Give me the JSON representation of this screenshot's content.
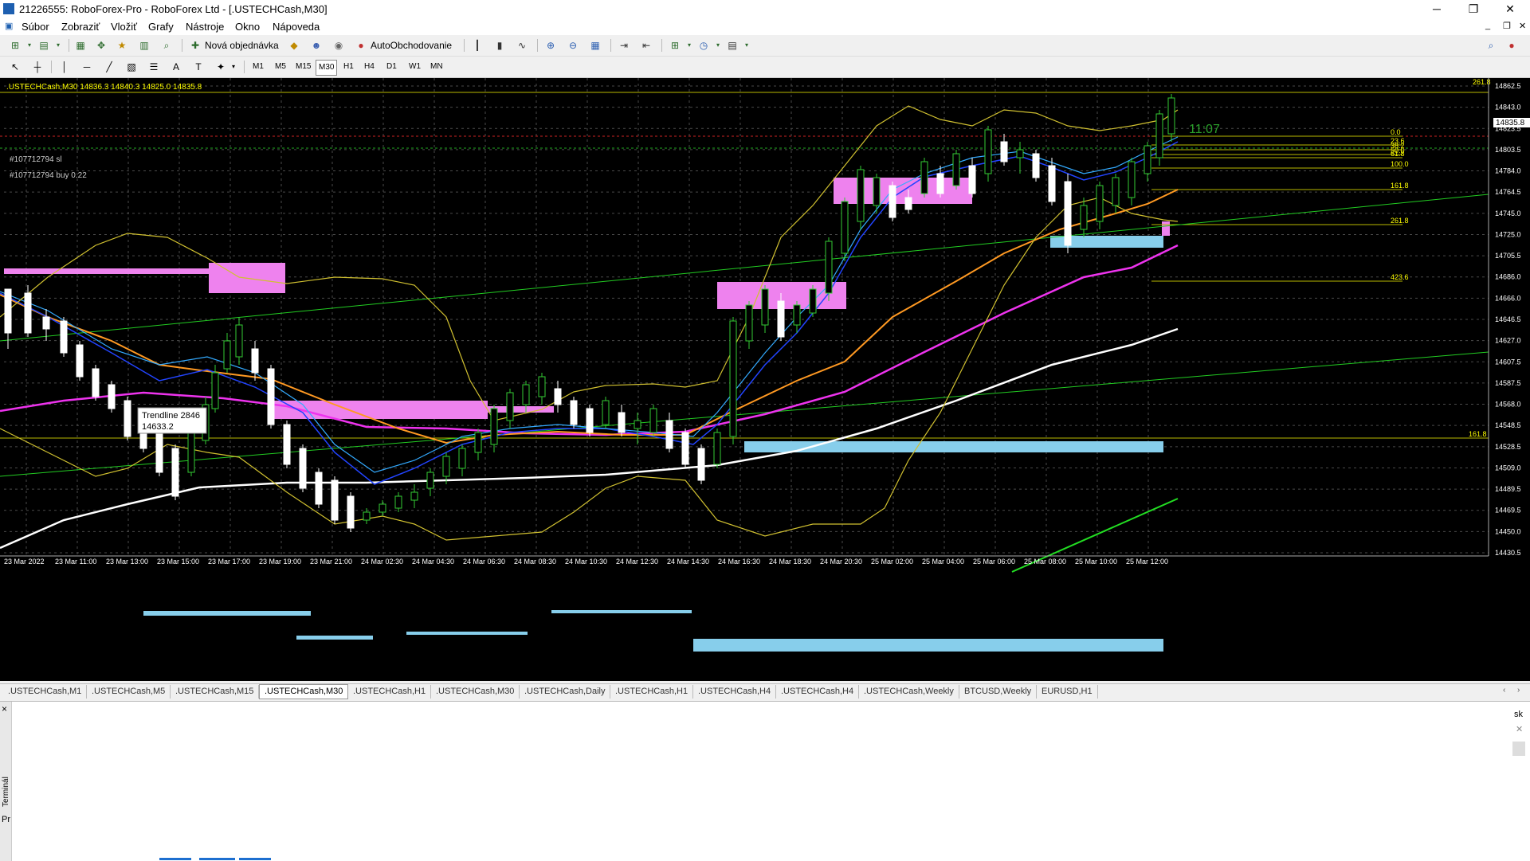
{
  "window": {
    "title": "21226555: RoboForex-Pro - RoboForex Ltd - [.USTECHCash,M30]"
  },
  "menu": [
    "Súbor",
    "Zobraziť",
    "Vložiť",
    "Grafy",
    "Nástroje",
    "Okno",
    "Nápoveda"
  ],
  "toolbar": {
    "new_order": "Nová objednávka",
    "auto_trading": "AutoObchodovanie"
  },
  "timeframes": [
    "M1",
    "M5",
    "M15",
    "M30",
    "H1",
    "H4",
    "D1",
    "W1",
    "MN"
  ],
  "active_timeframe": "M30",
  "chart": {
    "info_line": ".USTECHCash,M30  14836.3 14840.3 14825.0 14835.8",
    "current_price": "14835.8",
    "countdown": "11:07",
    "sl_label": "#107712794 sl",
    "buy_label": "#107712794 buy 0.22",
    "tooltip_line1": "Trendline 2846",
    "tooltip_line2": "14633.2",
    "top_right_label": "261.8",
    "price_ticks": [
      "14862.5",
      "14843.0",
      "14823.5",
      "14803.5",
      "14784.0",
      "14764.5",
      "14745.0",
      "14725.0",
      "14705.5",
      "14686.0",
      "14666.0",
      "14646.5",
      "14627.0",
      "14607.5",
      "14587.5",
      "14568.0",
      "14548.5",
      "14528.5",
      "14509.0",
      "14489.5",
      "14469.5",
      "14450.0",
      "14430.5"
    ],
    "time_ticks": [
      "23 Mar 2022",
      "23 Mar 11:00",
      "23 Mar 13:00",
      "23 Mar 15:00",
      "23 Mar 17:00",
      "23 Mar 19:00",
      "23 Mar 21:00",
      "24 Mar 02:30",
      "24 Mar 04:30",
      "24 Mar 06:30",
      "24 Mar 08:30",
      "24 Mar 10:30",
      "24 Mar 12:30",
      "24 Mar 14:30",
      "24 Mar 16:30",
      "24 Mar 18:30",
      "24 Mar 20:30",
      "25 Mar 02:00",
      "25 Mar 04:00",
      "25 Mar 06:00",
      "25 Mar 08:00",
      "25 Mar 10:00",
      "25 Mar 12:00"
    ],
    "fib_levels": [
      "0.0",
      "23.6",
      "38.2",
      "50.0",
      "61.8",
      "100.0",
      "161.8",
      "261.8",
      "423.6"
    ],
    "fib_left": "161.8"
  },
  "chart_tabs": [
    ".USTECHCash,M1",
    ".USTECHCash,M5",
    ".USTECHCash,M15",
    ".USTECHCash,M30",
    ".USTECHCash,H1",
    ".USTECHCash,M30",
    ".USTECHCash,Daily",
    ".USTECHCash,H1",
    ".USTECHCash,H4",
    ".USTECHCash,H4",
    ".USTECHCash,Weekly",
    "BTCUSD,Weekly",
    "EURUSD,H1"
  ],
  "active_tab_index": 3,
  "terminal": {
    "label": "Terminál",
    "close": "×",
    "right_text": "sk"
  },
  "colors": {
    "bull": "#33cc33",
    "bear": "#ffffff",
    "magenta_zone": "#ee82ee",
    "blue_zone": "#87ceeb",
    "grid": "#4a4a4a"
  }
}
